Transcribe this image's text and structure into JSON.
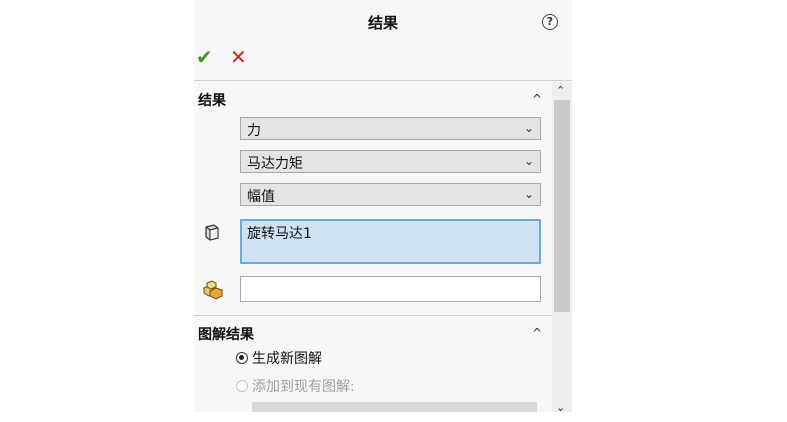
{
  "header": {
    "title": "结果",
    "help_glyph": "?",
    "ok_glyph": "✔",
    "cancel_glyph": "✕"
  },
  "results_section": {
    "title": "结果",
    "collapse_glyph": "^",
    "selects": [
      {
        "value": "力"
      },
      {
        "value": "马达力矩"
      },
      {
        "value": "幅值"
      }
    ],
    "component_list": [
      "旋转马达1"
    ],
    "reference_field_value": ""
  },
  "plot_section": {
    "title": "图解结果",
    "collapse_glyph": "^",
    "options": [
      {
        "label": "生成新图解",
        "selected": true,
        "enabled": true
      },
      {
        "label": "添加到现有图解:",
        "selected": false,
        "enabled": false
      }
    ]
  },
  "colors": {
    "ok": "#3f9a2c",
    "cancel": "#d0291b",
    "selection": "#cfe2f3",
    "selection_border": "#6fa8dc"
  },
  "icons": {
    "help": "help-icon",
    "ok": "check-icon",
    "cancel": "close-icon",
    "component": "part-icon",
    "reference": "assembly-icon"
  }
}
